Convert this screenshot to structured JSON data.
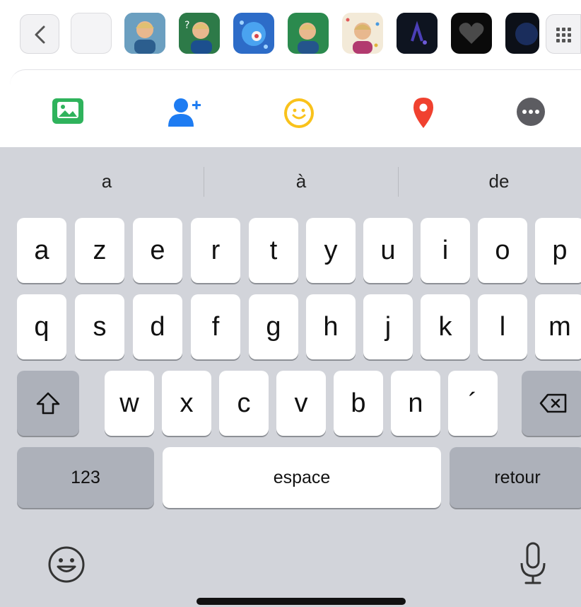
{
  "suggestions": [
    "a",
    "à",
    "de"
  ],
  "keyboard": {
    "row1": [
      "a",
      "z",
      "e",
      "r",
      "t",
      "y",
      "u",
      "i",
      "o",
      "p"
    ],
    "row2": [
      "q",
      "s",
      "d",
      "f",
      "g",
      "h",
      "j",
      "k",
      "l",
      "m"
    ],
    "row3": [
      "w",
      "x",
      "c",
      "v",
      "b",
      "n",
      "´"
    ],
    "numbers_label": "123",
    "space_label": "espace",
    "return_label": "retour"
  },
  "apps": [
    "photos-icon",
    "contacts-icon",
    "emoji-sticker-icon",
    "location-icon",
    "more-icon"
  ],
  "colors": {
    "photos": "#2fb35c",
    "contacts": "#1e7cf2",
    "emoji": "#f9c21b",
    "location": "#f0412f",
    "more": "#5c5c61",
    "keyboard_bg": "#d2d4da",
    "key_dark": "#adb1ba"
  }
}
